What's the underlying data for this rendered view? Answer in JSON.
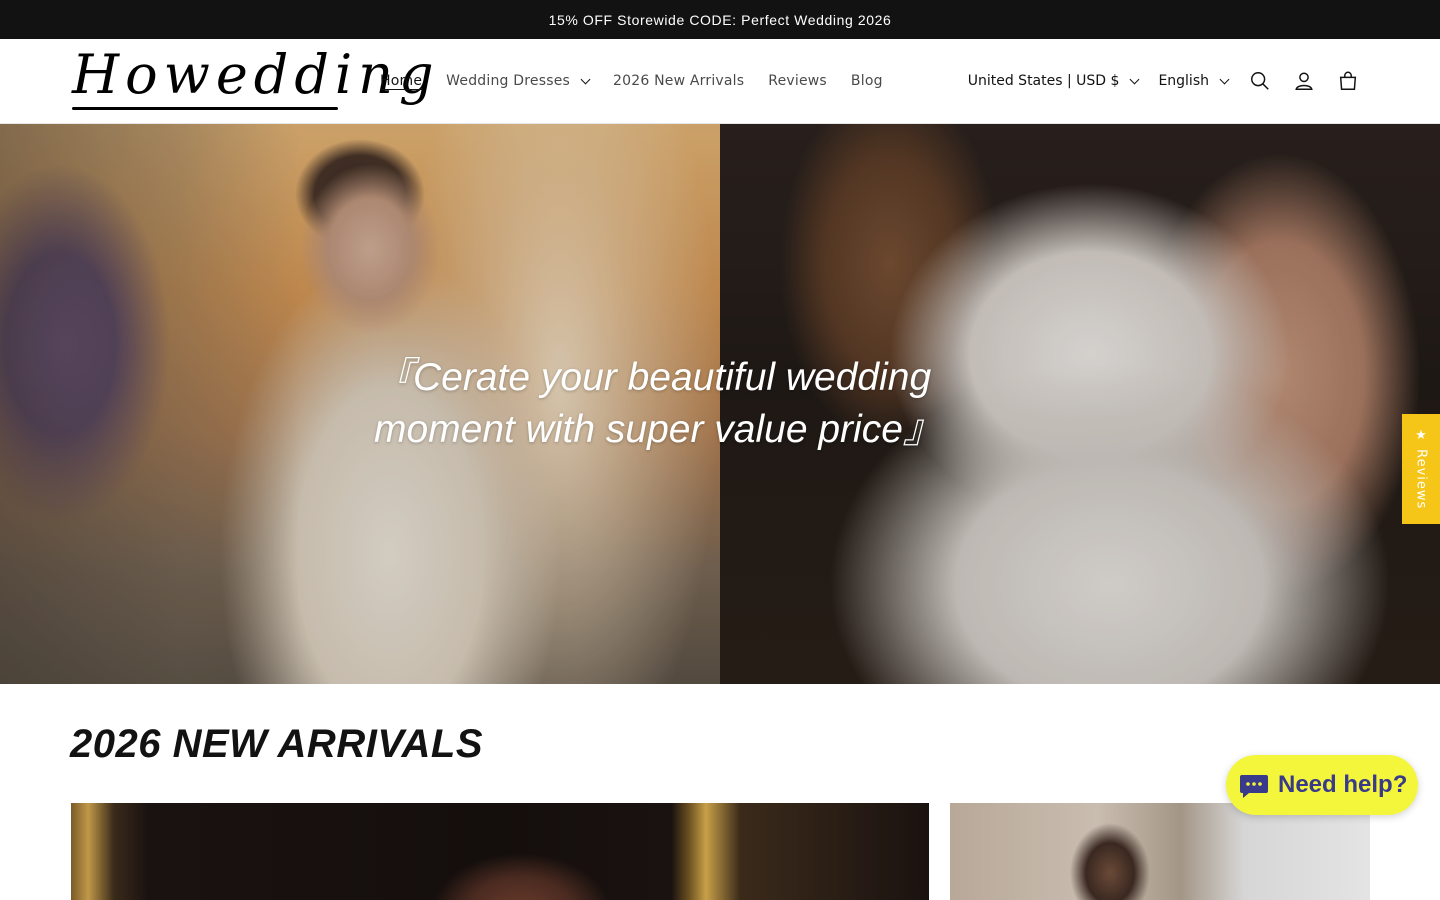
{
  "announcement": {
    "text": "15% OFF Storewide CODE: Perfect Wedding 2026"
  },
  "brand": {
    "name": "Howedding"
  },
  "nav": {
    "items": [
      {
        "label": "Home",
        "active": true,
        "dropdown": false
      },
      {
        "label": "Wedding Dresses",
        "active": false,
        "dropdown": true
      },
      {
        "label": "2026 New Arrivals",
        "active": false,
        "dropdown": false
      },
      {
        "label": "Reviews",
        "active": false,
        "dropdown": false
      },
      {
        "label": "Blog",
        "active": false,
        "dropdown": false
      }
    ]
  },
  "header": {
    "country": "United States | USD $",
    "language": "English",
    "icons": [
      "search-icon",
      "account-icon",
      "cart-icon"
    ]
  },
  "hero": {
    "quote": "『Cerate your beautiful wedding moment with super value price』"
  },
  "reviews_tab": {
    "label": "★ Reviews"
  },
  "section": {
    "title": "2026 NEW ARRIVALS"
  },
  "chat": {
    "label": "Need help?"
  },
  "colors": {
    "announcement_bg": "#121212",
    "reviews_tab_bg": "#f5c518",
    "chat_bg": "#f4f63c",
    "chat_text": "#3a3a8a"
  }
}
